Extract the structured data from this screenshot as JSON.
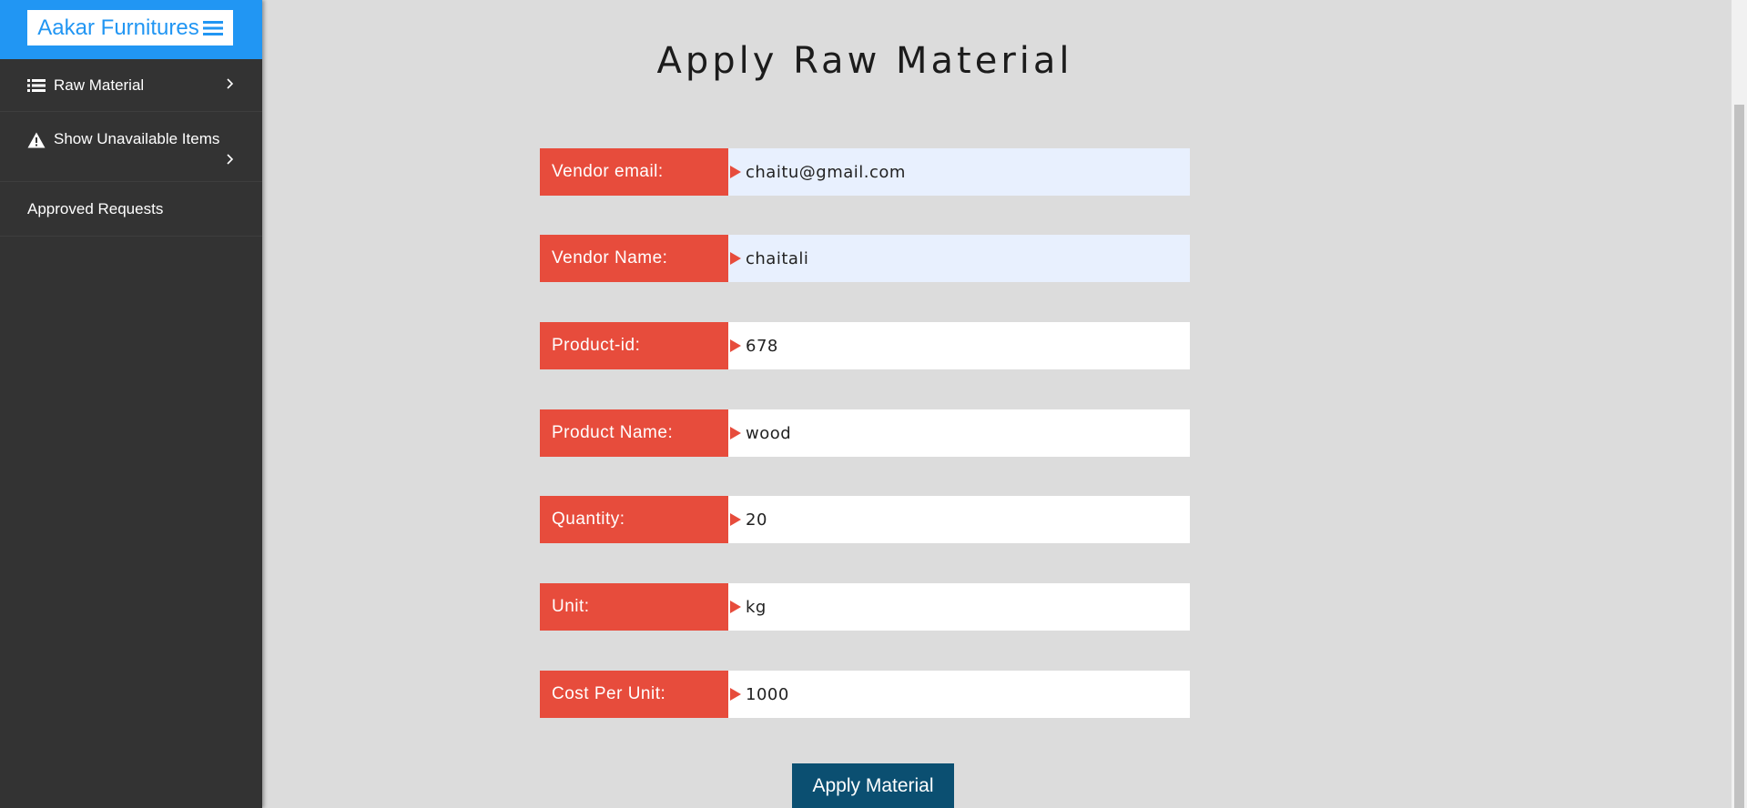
{
  "sidebar": {
    "brand": "Aakar Furnitures",
    "items": [
      {
        "label": "Raw Material",
        "icon": "list-icon"
      },
      {
        "label": "Show Unavailable Items",
        "icon": "warning-icon"
      },
      {
        "label": "Approved Requests"
      }
    ]
  },
  "main": {
    "title": "Apply Raw Material",
    "fields": [
      {
        "label": "Vendor email:",
        "value": "chaitu@gmail.com"
      },
      {
        "label": "Vendor Name:",
        "value": "chaitali"
      },
      {
        "label": "Product-id:",
        "value": "678"
      },
      {
        "label": "Product Name:",
        "value": "wood"
      },
      {
        "label": "Quantity:",
        "value": "20"
      },
      {
        "label": "Unit:",
        "value": "kg"
      },
      {
        "label": "Cost Per Unit:",
        "value": "1000"
      }
    ],
    "submit_label": "Apply Material"
  },
  "colors": {
    "sidebar_header": "#2196f3",
    "sidebar_bg": "#333333",
    "label_bg": "#e74c3c",
    "button_bg": "#0b4f71",
    "page_bg": "#dcdcdc",
    "autofill_bg": "#e8f0fe"
  }
}
